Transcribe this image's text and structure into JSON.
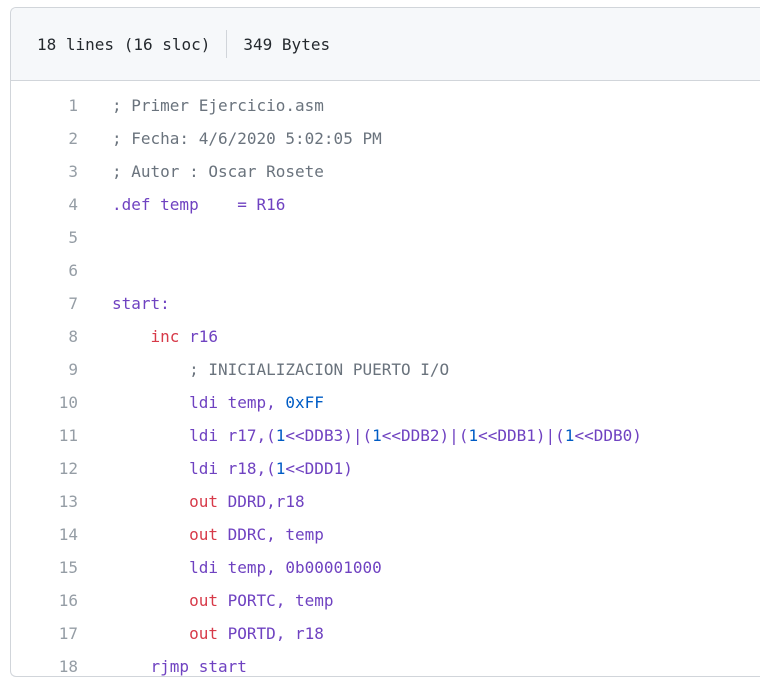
{
  "file_info": {
    "lines_label": "18 lines (16 sloc)",
    "size_label": "349 Bytes"
  },
  "code_lines": [
    {
      "num": "1",
      "tokens": [
        {
          "t": "; Primer Ejercicio.asm",
          "c": "c"
        }
      ]
    },
    {
      "num": "2",
      "tokens": [
        {
          "t": "; Fecha: 4/6/2020 5:02:05 PM",
          "c": "c"
        }
      ]
    },
    {
      "num": "3",
      "tokens": [
        {
          "t": "; Autor : Oscar Rosete",
          "c": "c"
        }
      ]
    },
    {
      "num": "4",
      "tokens": [
        {
          "t": ".def temp    = R16",
          "c": "p"
        }
      ]
    },
    {
      "num": "5",
      "tokens": []
    },
    {
      "num": "6",
      "tokens": []
    },
    {
      "num": "7",
      "tokens": [
        {
          "t": "start:",
          "c": "p"
        }
      ]
    },
    {
      "num": "8",
      "tokens": [
        {
          "t": "    ",
          "c": "d"
        },
        {
          "t": "inc",
          "c": "r"
        },
        {
          "t": " r16",
          "c": "p"
        }
      ]
    },
    {
      "num": "9",
      "tokens": [
        {
          "t": "        ",
          "c": "d"
        },
        {
          "t": "; INICIALIZACION PUERTO I/O",
          "c": "c"
        }
      ]
    },
    {
      "num": "10",
      "tokens": [
        {
          "t": "        ldi temp, ",
          "c": "p"
        },
        {
          "t": "0xFF",
          "c": "b"
        }
      ]
    },
    {
      "num": "11",
      "tokens": [
        {
          "t": "        ldi r17,(",
          "c": "p"
        },
        {
          "t": "1",
          "c": "b"
        },
        {
          "t": "<<DDB3)|(",
          "c": "p"
        },
        {
          "t": "1",
          "c": "b"
        },
        {
          "t": "<<DDB2)|(",
          "c": "p"
        },
        {
          "t": "1",
          "c": "b"
        },
        {
          "t": "<<DDB1)|(",
          "c": "p"
        },
        {
          "t": "1",
          "c": "b"
        },
        {
          "t": "<<DDB0)",
          "c": "p"
        }
      ]
    },
    {
      "num": "12",
      "tokens": [
        {
          "t": "        ldi r18,(",
          "c": "p"
        },
        {
          "t": "1",
          "c": "b"
        },
        {
          "t": "<<DDD1)",
          "c": "p"
        }
      ]
    },
    {
      "num": "13",
      "tokens": [
        {
          "t": "        ",
          "c": "d"
        },
        {
          "t": "out",
          "c": "r"
        },
        {
          "t": " DDRD,",
          "c": "p"
        },
        {
          "t": "r18",
          "c": "p"
        }
      ]
    },
    {
      "num": "14",
      "tokens": [
        {
          "t": "        ",
          "c": "d"
        },
        {
          "t": "out",
          "c": "r"
        },
        {
          "t": " DDRC, temp",
          "c": "p"
        }
      ]
    },
    {
      "num": "15",
      "tokens": [
        {
          "t": "        ldi temp, 0b00001000",
          "c": "p"
        }
      ]
    },
    {
      "num": "16",
      "tokens": [
        {
          "t": "        ",
          "c": "d"
        },
        {
          "t": "out",
          "c": "r"
        },
        {
          "t": " PORTC, temp",
          "c": "p"
        }
      ]
    },
    {
      "num": "17",
      "tokens": [
        {
          "t": "        ",
          "c": "d"
        },
        {
          "t": "out",
          "c": "r"
        },
        {
          "t": " PORTD, r18",
          "c": "p"
        }
      ]
    },
    {
      "num": "18",
      "tokens": [
        {
          "t": "    rjmp start",
          "c": "p"
        }
      ]
    }
  ]
}
